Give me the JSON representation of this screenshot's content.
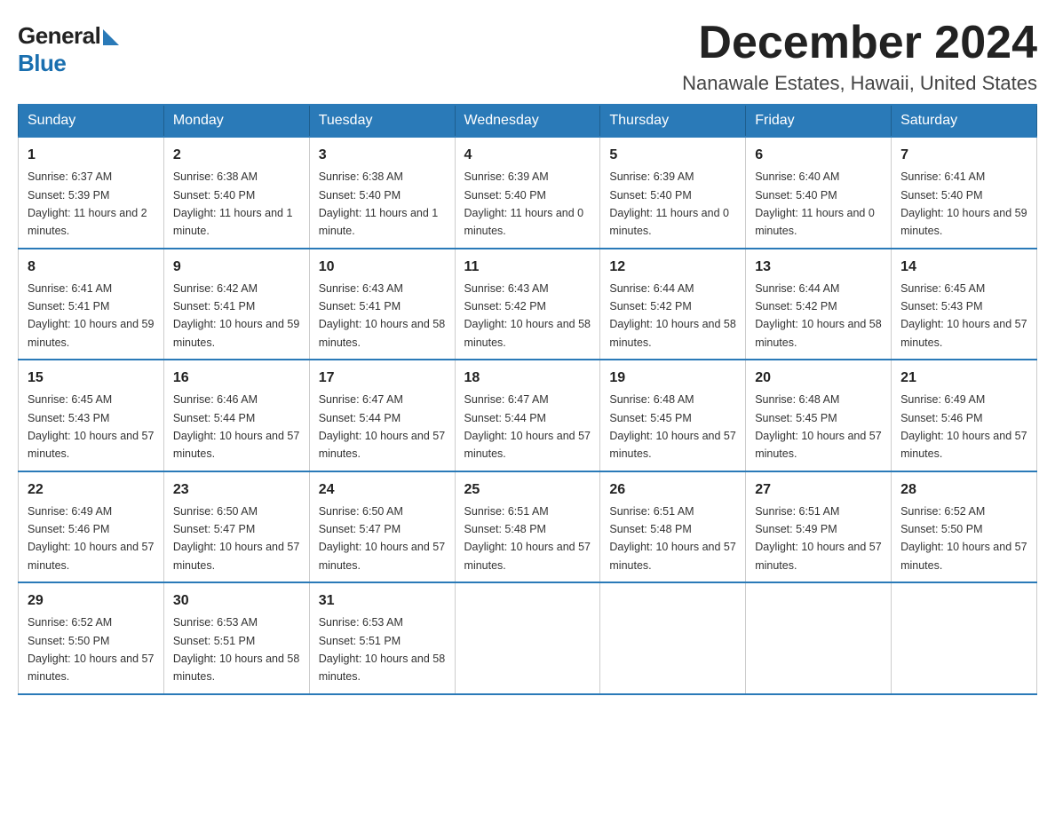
{
  "logo": {
    "general": "General",
    "blue": "Blue"
  },
  "title": {
    "month": "December 2024",
    "location": "Nanawale Estates, Hawaii, United States"
  },
  "weekdays": [
    "Sunday",
    "Monday",
    "Tuesday",
    "Wednesday",
    "Thursday",
    "Friday",
    "Saturday"
  ],
  "weeks": [
    [
      {
        "day": "1",
        "sunrise": "6:37 AM",
        "sunset": "5:39 PM",
        "daylight": "11 hours and 2 minutes."
      },
      {
        "day": "2",
        "sunrise": "6:38 AM",
        "sunset": "5:40 PM",
        "daylight": "11 hours and 1 minute."
      },
      {
        "day": "3",
        "sunrise": "6:38 AM",
        "sunset": "5:40 PM",
        "daylight": "11 hours and 1 minute."
      },
      {
        "day": "4",
        "sunrise": "6:39 AM",
        "sunset": "5:40 PM",
        "daylight": "11 hours and 0 minutes."
      },
      {
        "day": "5",
        "sunrise": "6:39 AM",
        "sunset": "5:40 PM",
        "daylight": "11 hours and 0 minutes."
      },
      {
        "day": "6",
        "sunrise": "6:40 AM",
        "sunset": "5:40 PM",
        "daylight": "11 hours and 0 minutes."
      },
      {
        "day": "7",
        "sunrise": "6:41 AM",
        "sunset": "5:40 PM",
        "daylight": "10 hours and 59 minutes."
      }
    ],
    [
      {
        "day": "8",
        "sunrise": "6:41 AM",
        "sunset": "5:41 PM",
        "daylight": "10 hours and 59 minutes."
      },
      {
        "day": "9",
        "sunrise": "6:42 AM",
        "sunset": "5:41 PM",
        "daylight": "10 hours and 59 minutes."
      },
      {
        "day": "10",
        "sunrise": "6:43 AM",
        "sunset": "5:41 PM",
        "daylight": "10 hours and 58 minutes."
      },
      {
        "day": "11",
        "sunrise": "6:43 AM",
        "sunset": "5:42 PM",
        "daylight": "10 hours and 58 minutes."
      },
      {
        "day": "12",
        "sunrise": "6:44 AM",
        "sunset": "5:42 PM",
        "daylight": "10 hours and 58 minutes."
      },
      {
        "day": "13",
        "sunrise": "6:44 AM",
        "sunset": "5:42 PM",
        "daylight": "10 hours and 58 minutes."
      },
      {
        "day": "14",
        "sunrise": "6:45 AM",
        "sunset": "5:43 PM",
        "daylight": "10 hours and 57 minutes."
      }
    ],
    [
      {
        "day": "15",
        "sunrise": "6:45 AM",
        "sunset": "5:43 PM",
        "daylight": "10 hours and 57 minutes."
      },
      {
        "day": "16",
        "sunrise": "6:46 AM",
        "sunset": "5:44 PM",
        "daylight": "10 hours and 57 minutes."
      },
      {
        "day": "17",
        "sunrise": "6:47 AM",
        "sunset": "5:44 PM",
        "daylight": "10 hours and 57 minutes."
      },
      {
        "day": "18",
        "sunrise": "6:47 AM",
        "sunset": "5:44 PM",
        "daylight": "10 hours and 57 minutes."
      },
      {
        "day": "19",
        "sunrise": "6:48 AM",
        "sunset": "5:45 PM",
        "daylight": "10 hours and 57 minutes."
      },
      {
        "day": "20",
        "sunrise": "6:48 AM",
        "sunset": "5:45 PM",
        "daylight": "10 hours and 57 minutes."
      },
      {
        "day": "21",
        "sunrise": "6:49 AM",
        "sunset": "5:46 PM",
        "daylight": "10 hours and 57 minutes."
      }
    ],
    [
      {
        "day": "22",
        "sunrise": "6:49 AM",
        "sunset": "5:46 PM",
        "daylight": "10 hours and 57 minutes."
      },
      {
        "day": "23",
        "sunrise": "6:50 AM",
        "sunset": "5:47 PM",
        "daylight": "10 hours and 57 minutes."
      },
      {
        "day": "24",
        "sunrise": "6:50 AM",
        "sunset": "5:47 PM",
        "daylight": "10 hours and 57 minutes."
      },
      {
        "day": "25",
        "sunrise": "6:51 AM",
        "sunset": "5:48 PM",
        "daylight": "10 hours and 57 minutes."
      },
      {
        "day": "26",
        "sunrise": "6:51 AM",
        "sunset": "5:48 PM",
        "daylight": "10 hours and 57 minutes."
      },
      {
        "day": "27",
        "sunrise": "6:51 AM",
        "sunset": "5:49 PM",
        "daylight": "10 hours and 57 minutes."
      },
      {
        "day": "28",
        "sunrise": "6:52 AM",
        "sunset": "5:50 PM",
        "daylight": "10 hours and 57 minutes."
      }
    ],
    [
      {
        "day": "29",
        "sunrise": "6:52 AM",
        "sunset": "5:50 PM",
        "daylight": "10 hours and 57 minutes."
      },
      {
        "day": "30",
        "sunrise": "6:53 AM",
        "sunset": "5:51 PM",
        "daylight": "10 hours and 58 minutes."
      },
      {
        "day": "31",
        "sunrise": "6:53 AM",
        "sunset": "5:51 PM",
        "daylight": "10 hours and 58 minutes."
      },
      null,
      null,
      null,
      null
    ]
  ]
}
